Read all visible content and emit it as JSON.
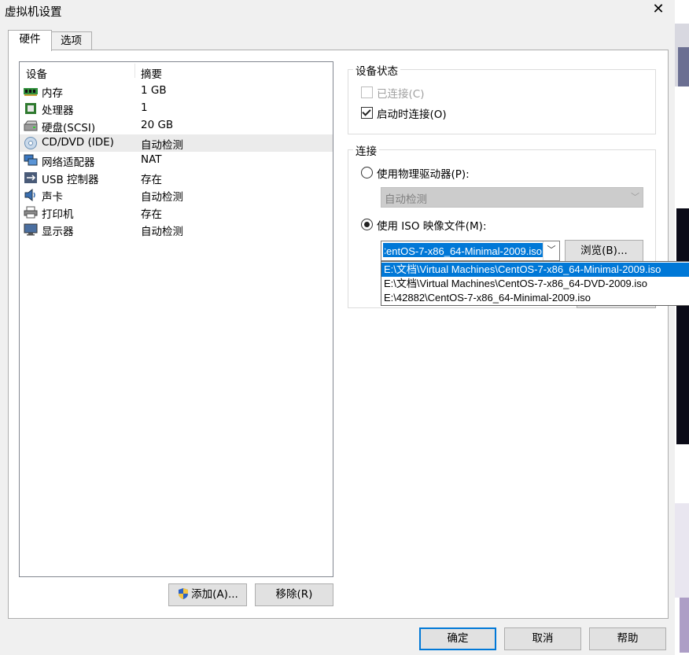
{
  "window": {
    "title": "虚拟机设置",
    "close_glyph": "✕"
  },
  "tabs": [
    {
      "label": "硬件"
    },
    {
      "label": "选项"
    }
  ],
  "device_list": {
    "columns": {
      "device": "设备",
      "summary": "摘要"
    },
    "rows": [
      {
        "name": "内存",
        "summary": "1 GB",
        "icon": "memory-icon"
      },
      {
        "name": "处理器",
        "summary": "1",
        "icon": "processor-icon"
      },
      {
        "name": "硬盘(SCSI)",
        "summary": "20 GB",
        "icon": "hard-disk-icon"
      },
      {
        "name": "CD/DVD (IDE)",
        "summary": "自动检测",
        "icon": "cd-dvd-icon",
        "selected": true
      },
      {
        "name": "网络适配器",
        "summary": "NAT",
        "icon": "network-adapter-icon"
      },
      {
        "name": "USB 控制器",
        "summary": "存在",
        "icon": "usb-icon"
      },
      {
        "name": "声卡",
        "summary": "自动检测",
        "icon": "sound-card-icon"
      },
      {
        "name": "打印机",
        "summary": "存在",
        "icon": "printer-icon"
      },
      {
        "name": "显示器",
        "summary": "自动检测",
        "icon": "display-icon"
      }
    ]
  },
  "buttons": {
    "add": "添加(A)...",
    "remove": "移除(R)",
    "ok": "确定",
    "cancel": "取消",
    "help": "帮助",
    "browse": "浏览(B)..."
  },
  "device_status": {
    "legend": "设备状态",
    "connected": {
      "label": "已连接(C)",
      "checked": false,
      "enabled": false
    },
    "connect_on_power": {
      "label": "启动时连接(O)",
      "checked": true,
      "enabled": true
    }
  },
  "connection": {
    "legend": "连接",
    "physical": {
      "label": "使用物理驱动器(P):",
      "selected": false,
      "dropdown_value": "自动检测"
    },
    "iso": {
      "label": "使用 ISO 映像文件(M):",
      "selected": true,
      "value": "E:\\文档\\Virtual Machines\\CentOS-7-x86_64-Minimal-2009.iso",
      "options": [
        "E:\\文档\\Virtual Machines\\CentOS-7-x86_64-Minimal-2009.iso",
        "E:\\文档\\Virtual Machines\\CentOS-7-x86_64-DVD-2009.iso",
        "E:\\42882\\CentOS-7-x86_64-Minimal-2009.iso"
      ]
    }
  },
  "colors": {
    "selection": "#0078d7",
    "default_button_border": "#0078d7"
  }
}
